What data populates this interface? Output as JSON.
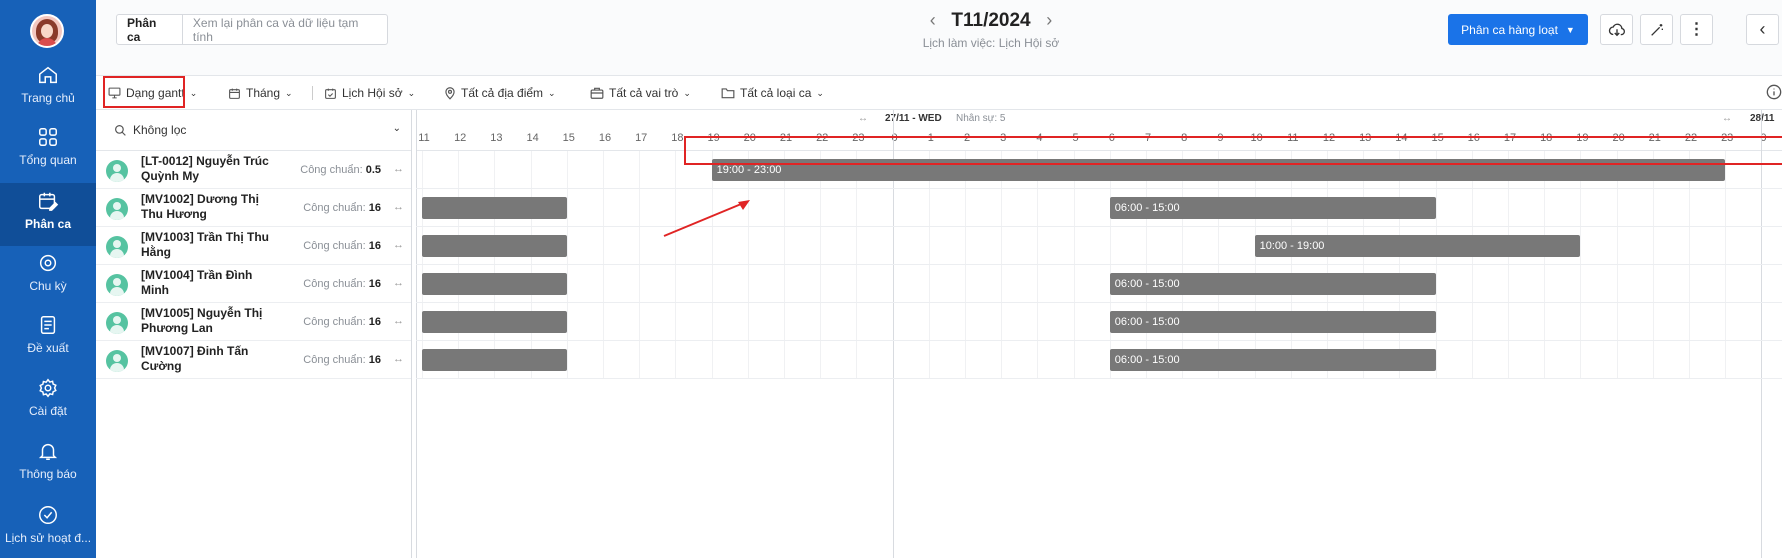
{
  "sidebar": {
    "items": [
      {
        "label": "Trang chủ",
        "icon": "home-icon"
      },
      {
        "label": "Tổng quan",
        "icon": "grid-icon"
      },
      {
        "label": "Phân ca",
        "icon": "calendar-edit-icon",
        "active": true
      },
      {
        "label": "Chu kỳ",
        "icon": "cycle-icon"
      },
      {
        "label": "Đề xuất",
        "icon": "document-icon"
      },
      {
        "label": "Cài đặt",
        "icon": "gear-icon"
      },
      {
        "label": "Thông báo",
        "icon": "bell-icon"
      },
      {
        "label": "Lịch sử hoạt đ...",
        "icon": "check-circle-icon"
      }
    ]
  },
  "header": {
    "tab_label": "Phân ca",
    "tab_subtitle": "Xem lại phân ca và dữ liệu tạm tính",
    "period_title": "T11/2024",
    "period_subtitle": "Lịch làm việc: Lịch Hội sở",
    "bulk_button": "Phân ca hàng loạt"
  },
  "filters": {
    "view": "Dạng gantt",
    "period": "Tháng",
    "schedule": "Lịch Hội sở",
    "location": "Tất cả địa điểm",
    "role": "Tất cả vai trò",
    "shift_type": "Tất cả loại ca"
  },
  "employee_panel": {
    "filter_label": "Không lọc",
    "employees": [
      {
        "name": "[LT-0012] Nguyễn Trúc Quỳnh My",
        "std_label": "Công chuẩn:",
        "std_value": "0.5"
      },
      {
        "name": "[MV1002] Dương Thị Thu Hương",
        "std_label": "Công chuẩn:",
        "std_value": "16"
      },
      {
        "name": "[MV1003] Trần Thị Thu Hằng",
        "std_label": "Công chuẩn:",
        "std_value": "16"
      },
      {
        "name": "[MV1004] Trần Đình Minh",
        "std_label": "Công chuẩn:",
        "std_value": "16"
      },
      {
        "name": "[MV1005] Nguyễn Thị Phương Lan",
        "std_label": "Công chuẩn:",
        "std_value": "16"
      },
      {
        "name": "[MV1007] Đinh Tấn Cường",
        "std_label": "Công chuẩn:",
        "std_value": "16"
      }
    ]
  },
  "gantt": {
    "day_label": "27/11 - WED",
    "staff_label": "Nhân sự: 5",
    "next_day_label": "28/11",
    "hours": [
      "11",
      "12",
      "13",
      "14",
      "15",
      "16",
      "17",
      "18",
      "19",
      "20",
      "21",
      "22",
      "23",
      "0",
      "1",
      "2",
      "3",
      "4",
      "5",
      "6",
      "7",
      "8",
      "9",
      "10",
      "11",
      "12",
      "13",
      "14",
      "15",
      "16",
      "17",
      "18",
      "19",
      "20",
      "21",
      "22",
      "23",
      "0"
    ],
    "shifts": [
      {
        "row": 0,
        "label": "19:00 - 23:00",
        "start_day": 0,
        "start": 19,
        "end_day": 1,
        "end": 23,
        "highlighted": true
      },
      {
        "row": 1,
        "label": "",
        "start_day": 0,
        "start": 11,
        "end_day": 0,
        "end": 15
      },
      {
        "row": 1,
        "label": "06:00 - 15:00",
        "start_day": 1,
        "start": 6,
        "end_day": 1,
        "end": 15
      },
      {
        "row": 2,
        "label": "",
        "start_day": 0,
        "start": 11,
        "end_day": 0,
        "end": 15
      },
      {
        "row": 2,
        "label": "10:00 - 19:00",
        "start_day": 1,
        "start": 10,
        "end_day": 1,
        "end": 19
      },
      {
        "row": 3,
        "label": "",
        "start_day": 0,
        "start": 11,
        "end_day": 0,
        "end": 15
      },
      {
        "row": 3,
        "label": "06:00 - 15:00",
        "start_day": 1,
        "start": 6,
        "end_day": 1,
        "end": 15
      },
      {
        "row": 4,
        "label": "",
        "start_day": 0,
        "start": 11,
        "end_day": 0,
        "end": 15
      },
      {
        "row": 4,
        "label": "06:00 - 15:00",
        "start_day": 1,
        "start": 6,
        "end_day": 1,
        "end": 15
      },
      {
        "row": 5,
        "label": "",
        "start_day": 0,
        "start": 11,
        "end_day": 0,
        "end": 15
      },
      {
        "row": 5,
        "label": "06:00 - 15:00",
        "start_day": 1,
        "start": 6,
        "end_day": 1,
        "end": 15
      }
    ]
  },
  "colors": {
    "sidebar": "#1761b8",
    "primary": "#1a73e8",
    "shift_bar": "#787878",
    "highlight": "#e02424",
    "avatar": "#56c3a1"
  }
}
